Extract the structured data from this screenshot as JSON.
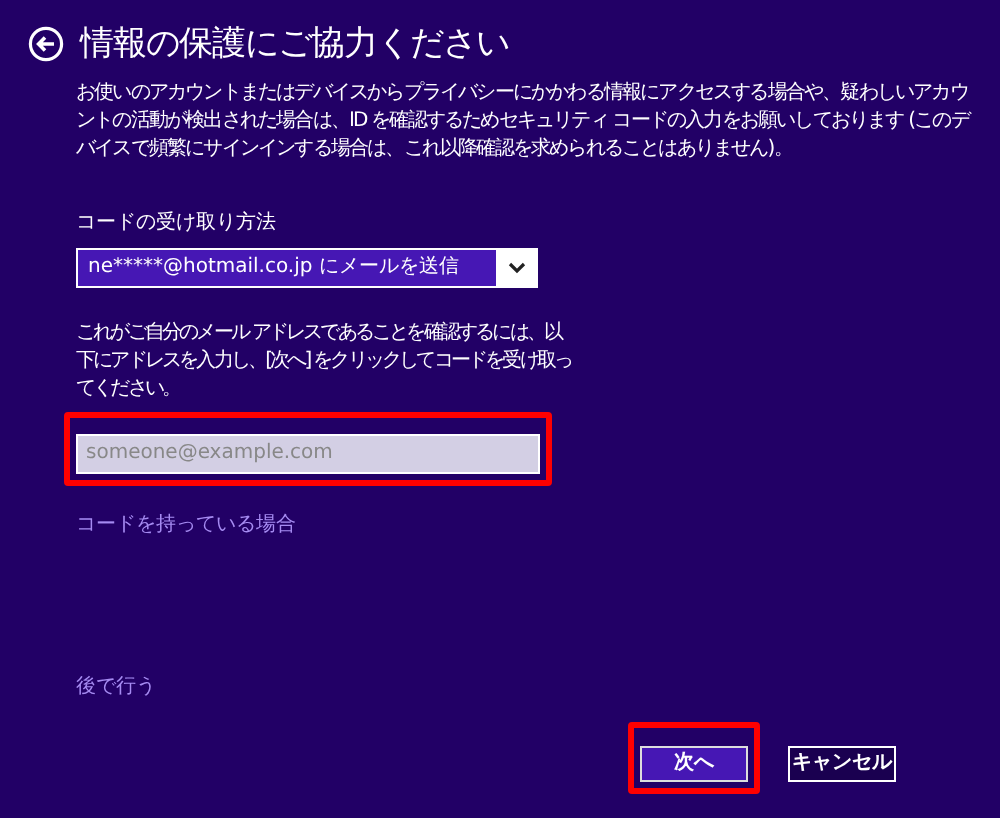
{
  "title": "情報の保護にご協力ください",
  "intro": "お使いのアカウントまたはデバイスからプライバシーにかかわる情報にアクセスする場合や、疑わしいアカウントの活動が検出された場合は、ID を確認するためセキュリティ コードの入力をお願いしております (このデバイスで頻繁にサインインする場合は、これ以降確認を求められることはありません)。",
  "method": {
    "label": "コードの受け取り方法",
    "value": "ne*****@hotmail.co.jp にメールを送信"
  },
  "instruction": "これがご自分のメール アドレスであることを確認するには、以下にアドレスを入力し、[次へ] をクリックしてコードを受け取ってください。",
  "email": {
    "placeholder": "someone@example.com",
    "highlighted": true
  },
  "have_code_link": "コードを持っている場合",
  "later_link": "後で行う",
  "buttons": [
    {
      "label": "次へ",
      "kind": "primary",
      "highlighted": true
    },
    {
      "label": "キャンセル",
      "kind": "secondary",
      "highlighted": false
    }
  ]
}
